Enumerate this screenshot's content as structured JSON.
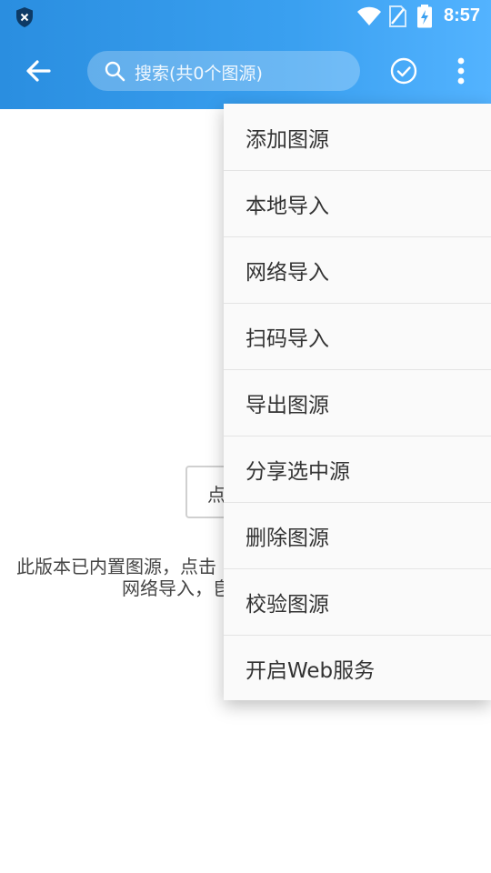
{
  "status_bar": {
    "time": "8:57",
    "icons": [
      "shield-x-icon",
      "wifi-icon",
      "no-sim-icon",
      "battery-charging-icon"
    ]
  },
  "app_bar": {
    "search_placeholder": "搜索(共0个图源)",
    "icons": [
      "back-arrow-icon",
      "search-icon",
      "check-circle-icon",
      "more-vert-icon"
    ],
    "color_start": "#2a8ee0",
    "color_end": "#53b3ff"
  },
  "content": {
    "button_label_visible": "点",
    "hint_line1": "此版本已内置图源，点击",
    "hint_line2": "网络导入，皀"
  },
  "menu": {
    "items": [
      "添加图源",
      "本地导入",
      "网络导入",
      "扫码导入",
      "导出图源",
      "分享选中源",
      "删除图源",
      "校验图源",
      "开启Web服务"
    ]
  }
}
